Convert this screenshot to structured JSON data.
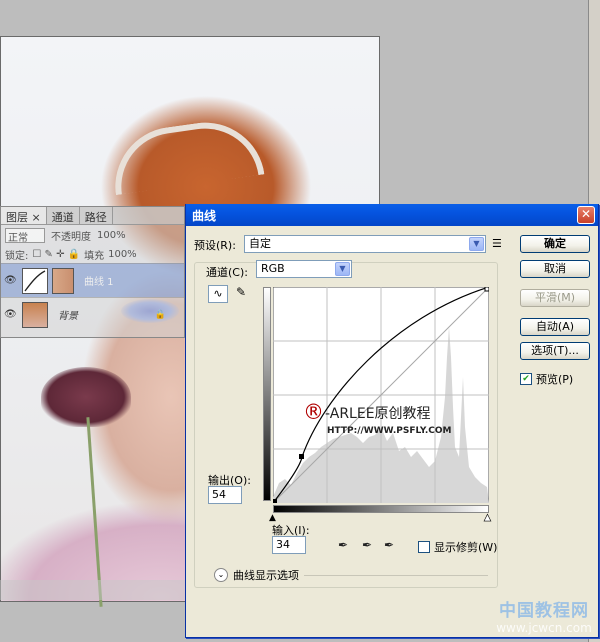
{
  "layers_panel": {
    "tabs": [
      "图层 ×",
      "通道",
      "路径"
    ],
    "blend_mode": "正常",
    "opacity_label": "不透明度",
    "opacity_value": "100%",
    "lock_label": "锁定:",
    "fill_label": "填充",
    "fill_value": "100%",
    "layers": [
      {
        "name": "曲线 1",
        "selected": true
      },
      {
        "name": "背景",
        "selected": false
      }
    ]
  },
  "curves_dialog": {
    "title": "曲线",
    "preset_label": "预设(R):",
    "preset_value": "自定",
    "channel_label": "通道(C):",
    "channel_value": "RGB",
    "ok_button": "确定",
    "cancel_button": "取消",
    "smooth_button": "平滑(M)",
    "auto_button": "自动(A)",
    "options_button": "选项(T)...",
    "preview_label": "预览(P)",
    "preview_checked": true,
    "output_label": "输出(O):",
    "output_value": "54",
    "input_label": "输入(I):",
    "input_value": "34",
    "show_clipping_label": "显示修剪(W)",
    "curve_options_label": "曲线显示选项",
    "graph_watermark_line1": "-ARLEE原创教程",
    "graph_watermark_line2": "HTTP://WWW.PSFLY.COM"
  },
  "watermark": {
    "line1": "中国教程网",
    "line2": "www.jcwcn.com"
  }
}
